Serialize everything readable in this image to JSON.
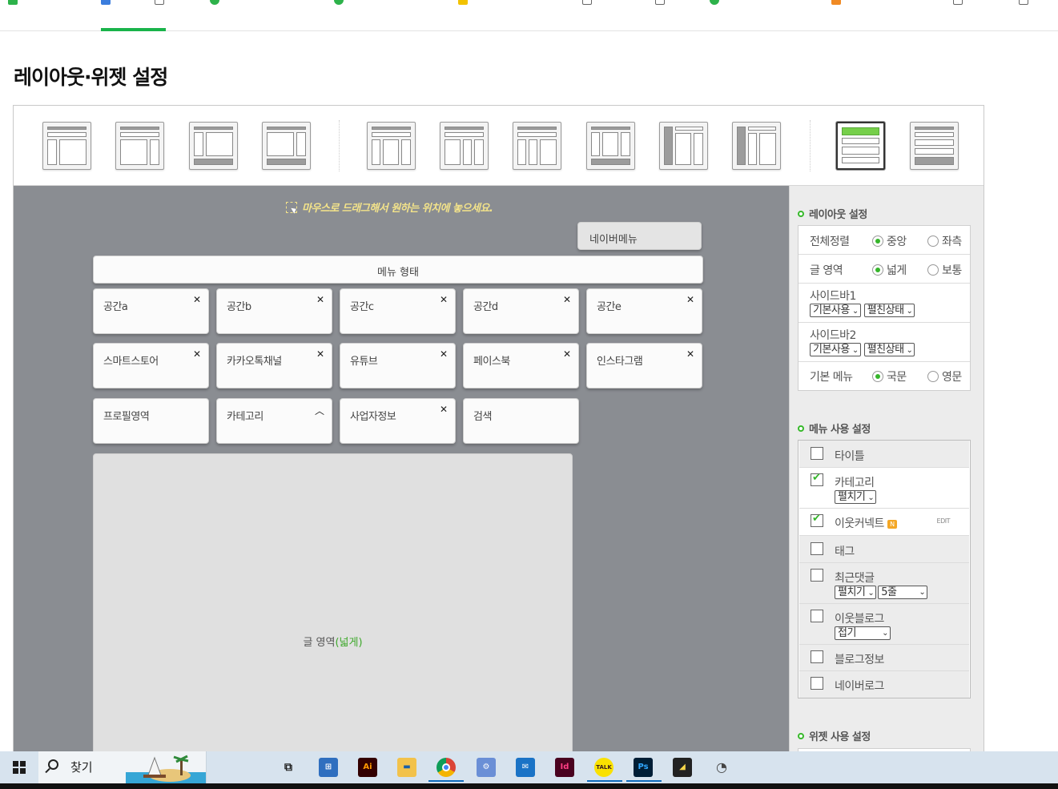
{
  "page": {
    "title": "레이아웃·위젯 설정"
  },
  "canvas": {
    "hint": "마우스로 드래그해서 원하는 위치에 놓으세요.",
    "naver_menu": "네이버메뉴",
    "menu_bar": "메뉴 형태",
    "widgets_row1": [
      "공간a",
      "공간b",
      "공간c",
      "공간d",
      "공간e"
    ],
    "widgets_row2": [
      "스마트스토어",
      "카카오톡채널",
      "유튜브",
      "페이스북",
      "인스타그램"
    ],
    "widgets_row3": [
      "프로필영역",
      "카테고리",
      "사업자정보",
      "검색"
    ],
    "content_label": "글 영역",
    "content_width": "(넓게)"
  },
  "layout_settings": {
    "title": "레이아웃 설정",
    "align_label": "전체정렬",
    "align_options": [
      "중앙",
      "좌측"
    ],
    "align_selected": "중앙",
    "content_label": "글 영역",
    "content_options": [
      "넓게",
      "보통"
    ],
    "content_selected": "넓게",
    "sidebar1_label": "사이드바1",
    "sidebar1_use": "기본사용",
    "sidebar1_state": "펼친상태",
    "sidebar2_label": "사이드바2",
    "sidebar2_use": "기본사용",
    "sidebar2_state": "펼친상태",
    "menu_lang_label": "기본 메뉴",
    "menu_lang_options": [
      "국문",
      "영문"
    ],
    "menu_lang_selected": "국문"
  },
  "menu_settings": {
    "title": "메뉴 사용 설정",
    "items": [
      {
        "label": "타이틀",
        "checked": false
      },
      {
        "label": "카테고리",
        "checked": true,
        "select1": "펼치기"
      },
      {
        "label": "이웃커넥트",
        "checked": true,
        "badge": "N",
        "edit": "EDIT"
      },
      {
        "label": "태그",
        "checked": false
      },
      {
        "label": "최근댓글",
        "checked": false,
        "select1": "펼치기",
        "select2": "5줄"
      },
      {
        "label": "이웃블로그",
        "checked": false,
        "select1": "접기"
      },
      {
        "label": "블로그정보",
        "checked": false
      },
      {
        "label": "네이버로그",
        "checked": false
      }
    ]
  },
  "widget_settings": {
    "title": "위젯 사용 설정"
  },
  "taskbar": {
    "search_label": "찾기",
    "apps": [
      "task-view",
      "store",
      "illustrator",
      "file-explorer",
      "chrome",
      "settings",
      "mail",
      "indesign",
      "kakaotalk",
      "photoshop",
      "sticky-notes",
      "other-app"
    ]
  },
  "colors": {
    "accent_green": "#37b92b",
    "canvas_gray": "#8a8d92",
    "hint_yellow": "#f3e38a"
  }
}
